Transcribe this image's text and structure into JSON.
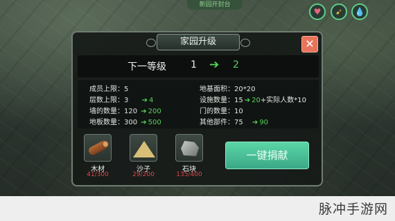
{
  "hud": {
    "top_label": "新园开封台",
    "buttons": [
      "heart-icon",
      "bird-icon",
      "water-drop-icon"
    ]
  },
  "dialog": {
    "title": "家园升级",
    "close": "✕",
    "level_label": "下一等级",
    "current_level": "1",
    "arrow": "➔",
    "next_level": "2"
  },
  "stats": {
    "members": {
      "label": "成员上限：",
      "value": "5"
    },
    "floors": {
      "label": "层数上限：",
      "value": "3",
      "arrow": "➔",
      "next": "4"
    },
    "walls": {
      "label": "墙的数量：",
      "value": "120",
      "arrow": "➔",
      "next": "200"
    },
    "floor_boards": {
      "label": "地板数量：",
      "value": "300",
      "arrow": "➔",
      "next": "500"
    },
    "base_area": {
      "label": "地基面积：",
      "value": "20*20"
    },
    "facilities": {
      "label": "设施数量：",
      "value": "15",
      "arrow": "➔",
      "next": "20",
      "extra": "+实际人数*10"
    },
    "doors": {
      "label": "门的数量：",
      "value": "10"
    },
    "other_parts": {
      "label": "其他部件：",
      "value": "75",
      "arrow": "➔",
      "next": "90"
    }
  },
  "resources": [
    {
      "name": "木材",
      "count": "41/300",
      "icon": "wood-log-icon"
    },
    {
      "name": "沙子",
      "count": "29/200",
      "icon": "sand-pile-icon"
    },
    {
      "name": "石块",
      "count": "135/400",
      "icon": "stone-icon"
    }
  ],
  "donate_button": "一键捐献",
  "watermark": "脉冲手游网",
  "colors": {
    "accent_green": "#57d35a",
    "donate_button": "#4cc499",
    "close_button": "#e8735b",
    "resource_count": "#e0454a"
  }
}
